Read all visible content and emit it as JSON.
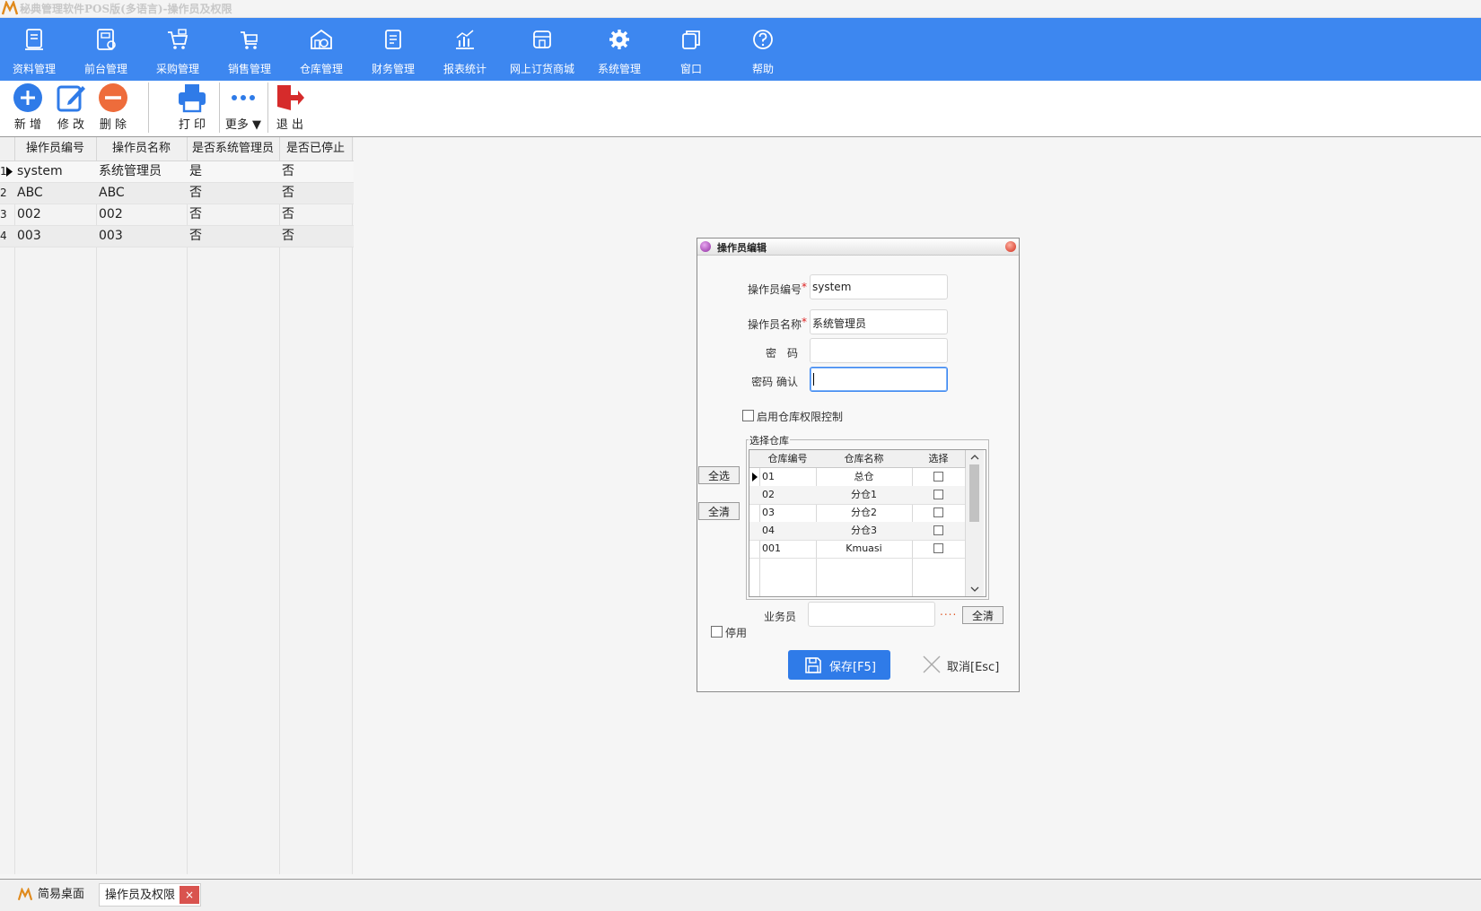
{
  "window": {
    "title": "秘典管理软件POS版(多语言)-操作员及权限"
  },
  "menu": {
    "items": [
      {
        "label": "资料管理",
        "icon": "document-icon"
      },
      {
        "label": "前台管理",
        "icon": "register-icon"
      },
      {
        "label": "采购管理",
        "icon": "cart-icon"
      },
      {
        "label": "销售管理",
        "icon": "trolley-icon"
      },
      {
        "label": "仓库管理",
        "icon": "warehouse-icon"
      },
      {
        "label": "财务管理",
        "icon": "ledger-icon"
      },
      {
        "label": "报表统计",
        "icon": "chart-icon"
      },
      {
        "label": "网上订货商城",
        "icon": "store-icon"
      },
      {
        "label": "系统管理",
        "icon": "gear-icon"
      },
      {
        "label": "窗口",
        "icon": "window-icon"
      },
      {
        "label": "帮助",
        "icon": "help-icon"
      }
    ]
  },
  "toolbar": {
    "add": "新 增",
    "edit": "修 改",
    "delete": "删 除",
    "print": "打 印",
    "more": "更多 ▼",
    "exit": "退 出"
  },
  "grid": {
    "columns": [
      "操作员编号",
      "操作员名称",
      "是否系统管理员",
      "是否已停止"
    ],
    "rows": [
      {
        "num": "1",
        "code": "system",
        "name": "系统管理员",
        "admin": "是",
        "stopped": "否"
      },
      {
        "num": "2",
        "code": "ABC",
        "name": "ABC",
        "admin": "否",
        "stopped": "否"
      },
      {
        "num": "3",
        "code": "002",
        "name": "002",
        "admin": "否",
        "stopped": "否"
      },
      {
        "num": "4",
        "code": "003",
        "name": "003",
        "admin": "否",
        "stopped": "否"
      }
    ]
  },
  "dialog": {
    "title": "操作员编辑",
    "fields": {
      "code_label": "操作员编号",
      "code_value": "system",
      "name_label": "操作员名称",
      "name_value": "系统管理员",
      "password_label": "密　码",
      "password_value": "",
      "confirm_label": "密码 确认",
      "confirm_value": "",
      "required_mark": "*"
    },
    "warehouse_control_label": "启用仓库权限控制",
    "warehouse_group_label": "选择仓库",
    "select_all": "全选",
    "clear_all": "全清",
    "warehouse_columns": [
      "仓库编号",
      "仓库名称",
      "选择"
    ],
    "warehouses": [
      {
        "code": "01",
        "name": "总仓",
        "selected": false
      },
      {
        "code": "02",
        "name": "分仓1",
        "selected": false
      },
      {
        "code": "03",
        "name": "分仓2",
        "selected": false
      },
      {
        "code": "04",
        "name": "分仓3",
        "selected": false
      },
      {
        "code": "001",
        "name": "Kmuasi",
        "selected": false
      }
    ],
    "salesman_label": "业务员",
    "salesman_value": "",
    "salesman_browse": "....",
    "salesman_clear": "全清",
    "disable_label": "停用",
    "save": "保存[F5]",
    "cancel": "取消[Esc]"
  },
  "statusbar": {
    "tabs": [
      {
        "label": "简易桌面"
      },
      {
        "label": "操作员及权限"
      }
    ],
    "close": "×"
  },
  "colors": {
    "menu_bg": "#3d87f0",
    "save_bg": "#2f7be8",
    "close_tab": "#d9534f"
  }
}
